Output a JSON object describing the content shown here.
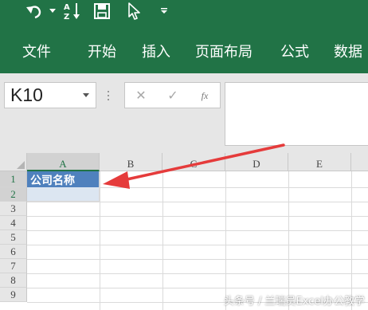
{
  "colors": {
    "accent": "#217346",
    "header_cell": "#4f81bd",
    "selection": "#dce6f1",
    "arrow": "#e53b3b"
  },
  "qat": {
    "undo_icon": "undo-icon",
    "sort_icon": "sort-az-icon",
    "save_icon": "save-icon",
    "pointer_icon": "pointer-icon",
    "customize_icon": "chevron-down-icon"
  },
  "ribbon": {
    "tabs": [
      {
        "label": "文件"
      },
      {
        "label": "开始"
      },
      {
        "label": "插入"
      },
      {
        "label": "页面布局"
      },
      {
        "label": "公式"
      },
      {
        "label": "数据"
      }
    ]
  },
  "formula_bar": {
    "name_box": "K10",
    "cancel": "✕",
    "enter": "✓",
    "fx": "fx",
    "value": ""
  },
  "grid": {
    "columns": [
      "A",
      "B",
      "C",
      "D",
      "E"
    ],
    "rows": [
      "1",
      "2",
      "3",
      "4",
      "5",
      "6",
      "7",
      "8",
      "9"
    ],
    "cells": {
      "A1": "公司名称"
    }
  },
  "watermark": "头条号 / 兰瑞员Excel办公教学"
}
